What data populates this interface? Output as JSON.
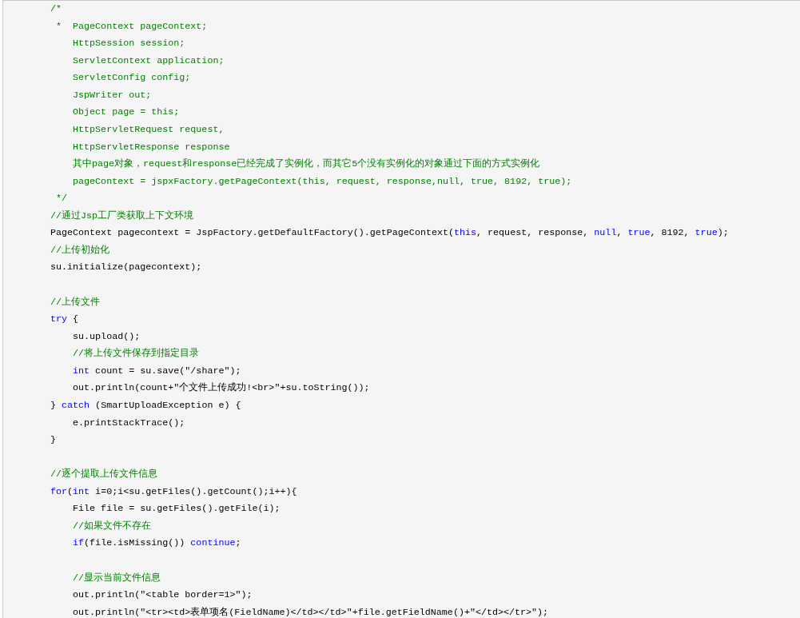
{
  "code_lines": [
    {
      "kind": "code",
      "tokens": [
        {
          "kind": "comment",
          "text": "/*"
        }
      ]
    },
    {
      "kind": "code",
      "tokens": [
        {
          "kind": "comment",
          "text": " *  PageContext pageContext;"
        }
      ]
    },
    {
      "kind": "code",
      "tokens": [
        {
          "kind": "comment",
          "text": "    HttpSession session;"
        }
      ]
    },
    {
      "kind": "code",
      "tokens": [
        {
          "kind": "comment",
          "text": "    ServletContext application;"
        }
      ]
    },
    {
      "kind": "code",
      "tokens": [
        {
          "kind": "comment",
          "text": "    ServletConfig config;"
        }
      ]
    },
    {
      "kind": "code",
      "tokens": [
        {
          "kind": "comment",
          "text": "    JspWriter out;"
        }
      ]
    },
    {
      "kind": "code",
      "tokens": [
        {
          "kind": "comment",
          "text": "    Object page = this;"
        }
      ]
    },
    {
      "kind": "code",
      "tokens": [
        {
          "kind": "comment",
          "text": "    HttpServletRequest request,"
        }
      ]
    },
    {
      "kind": "code",
      "tokens": [
        {
          "kind": "comment",
          "text": "    HttpServletResponse response"
        }
      ]
    },
    {
      "kind": "code",
      "tokens": [
        {
          "kind": "comment",
          "text": "    其中page对象，request和response已经完成了实例化，而其它5个没有实例化的对象通过下面的方式实例化"
        }
      ]
    },
    {
      "kind": "code",
      "tokens": [
        {
          "kind": "comment",
          "text": "    pageContext = jspxFactory.getPageContext(this, request, response,null, true, 8192, true);"
        }
      ]
    },
    {
      "kind": "code",
      "tokens": [
        {
          "kind": "comment",
          "text": " */"
        }
      ]
    },
    {
      "kind": "code",
      "tokens": [
        {
          "kind": "comment",
          "text": "//通过Jsp工厂类获取上下文环境"
        }
      ]
    },
    {
      "kind": "code",
      "tokens": [
        {
          "kind": "plain",
          "text": "PageContext pagecontext = JspFactory.getDefaultFactory().getPageContext("
        },
        {
          "kind": "keyword",
          "text": "this"
        },
        {
          "kind": "plain",
          "text": ", request, response, "
        },
        {
          "kind": "keyword",
          "text": "null"
        },
        {
          "kind": "plain",
          "text": ", "
        },
        {
          "kind": "keyword",
          "text": "true"
        },
        {
          "kind": "plain",
          "text": ", 8192, "
        },
        {
          "kind": "keyword",
          "text": "true"
        },
        {
          "kind": "plain",
          "text": ");"
        }
      ]
    },
    {
      "kind": "code",
      "tokens": [
        {
          "kind": "comment",
          "text": "//上传初始化"
        }
      ]
    },
    {
      "kind": "code",
      "tokens": [
        {
          "kind": "plain",
          "text": "su.initialize(pagecontext);"
        }
      ]
    },
    {
      "kind": "blank"
    },
    {
      "kind": "code",
      "tokens": [
        {
          "kind": "comment",
          "text": "//上传文件"
        }
      ]
    },
    {
      "kind": "code",
      "tokens": [
        {
          "kind": "keyword",
          "text": "try"
        },
        {
          "kind": "plain",
          "text": " {"
        }
      ]
    },
    {
      "kind": "code",
      "tokens": [
        {
          "kind": "plain",
          "text": "    su.upload();"
        }
      ]
    },
    {
      "kind": "code",
      "tokens": [
        {
          "kind": "comment",
          "text": "    //将上传文件保存到指定目录"
        }
      ]
    },
    {
      "kind": "code",
      "tokens": [
        {
          "kind": "keyword",
          "text": "    int"
        },
        {
          "kind": "plain",
          "text": " count = su.save(\"/share\");"
        }
      ]
    },
    {
      "kind": "code",
      "tokens": [
        {
          "kind": "plain",
          "text": "    out.println(count+\"个文件上传成功!<br>\"+su.toString());"
        }
      ]
    },
    {
      "kind": "code",
      "tokens": [
        {
          "kind": "plain",
          "text": "} "
        },
        {
          "kind": "keyword",
          "text": "catch"
        },
        {
          "kind": "plain",
          "text": " (SmartUploadException e) {"
        }
      ]
    },
    {
      "kind": "code",
      "tokens": [
        {
          "kind": "plain",
          "text": "    e.printStackTrace();"
        }
      ]
    },
    {
      "kind": "code",
      "tokens": [
        {
          "kind": "plain",
          "text": "}"
        }
      ]
    },
    {
      "kind": "blank"
    },
    {
      "kind": "code",
      "tokens": [
        {
          "kind": "comment",
          "text": "//逐个提取上传文件信息"
        }
      ]
    },
    {
      "kind": "code",
      "tokens": [
        {
          "kind": "keyword",
          "text": "for"
        },
        {
          "kind": "plain",
          "text": "("
        },
        {
          "kind": "keyword",
          "text": "int"
        },
        {
          "kind": "plain",
          "text": " i=0;i<su.getFiles().getCount();i++){"
        }
      ]
    },
    {
      "kind": "code",
      "tokens": [
        {
          "kind": "plain",
          "text": "    File file = su.getFiles().getFile(i);"
        }
      ]
    },
    {
      "kind": "code",
      "tokens": [
        {
          "kind": "comment",
          "text": "    //如果文件不存在"
        }
      ]
    },
    {
      "kind": "code",
      "tokens": [
        {
          "kind": "keyword",
          "text": "    if"
        },
        {
          "kind": "plain",
          "text": "(file.isMissing()) "
        },
        {
          "kind": "keyword",
          "text": "continue"
        },
        {
          "kind": "plain",
          "text": ";"
        }
      ]
    },
    {
      "kind": "blank"
    },
    {
      "kind": "code",
      "tokens": [
        {
          "kind": "comment",
          "text": "    //显示当前文件信息"
        }
      ]
    },
    {
      "kind": "code",
      "tokens": [
        {
          "kind": "plain",
          "text": "    out.println(\"<table border=1>\");"
        }
      ]
    },
    {
      "kind": "code",
      "tokens": [
        {
          "kind": "plain",
          "text": "    out.println(\"<tr><td>表单项名(FieldName)</td></td>\"+file.getFieldName()+\"</td></tr>\");"
        }
      ]
    }
  ]
}
